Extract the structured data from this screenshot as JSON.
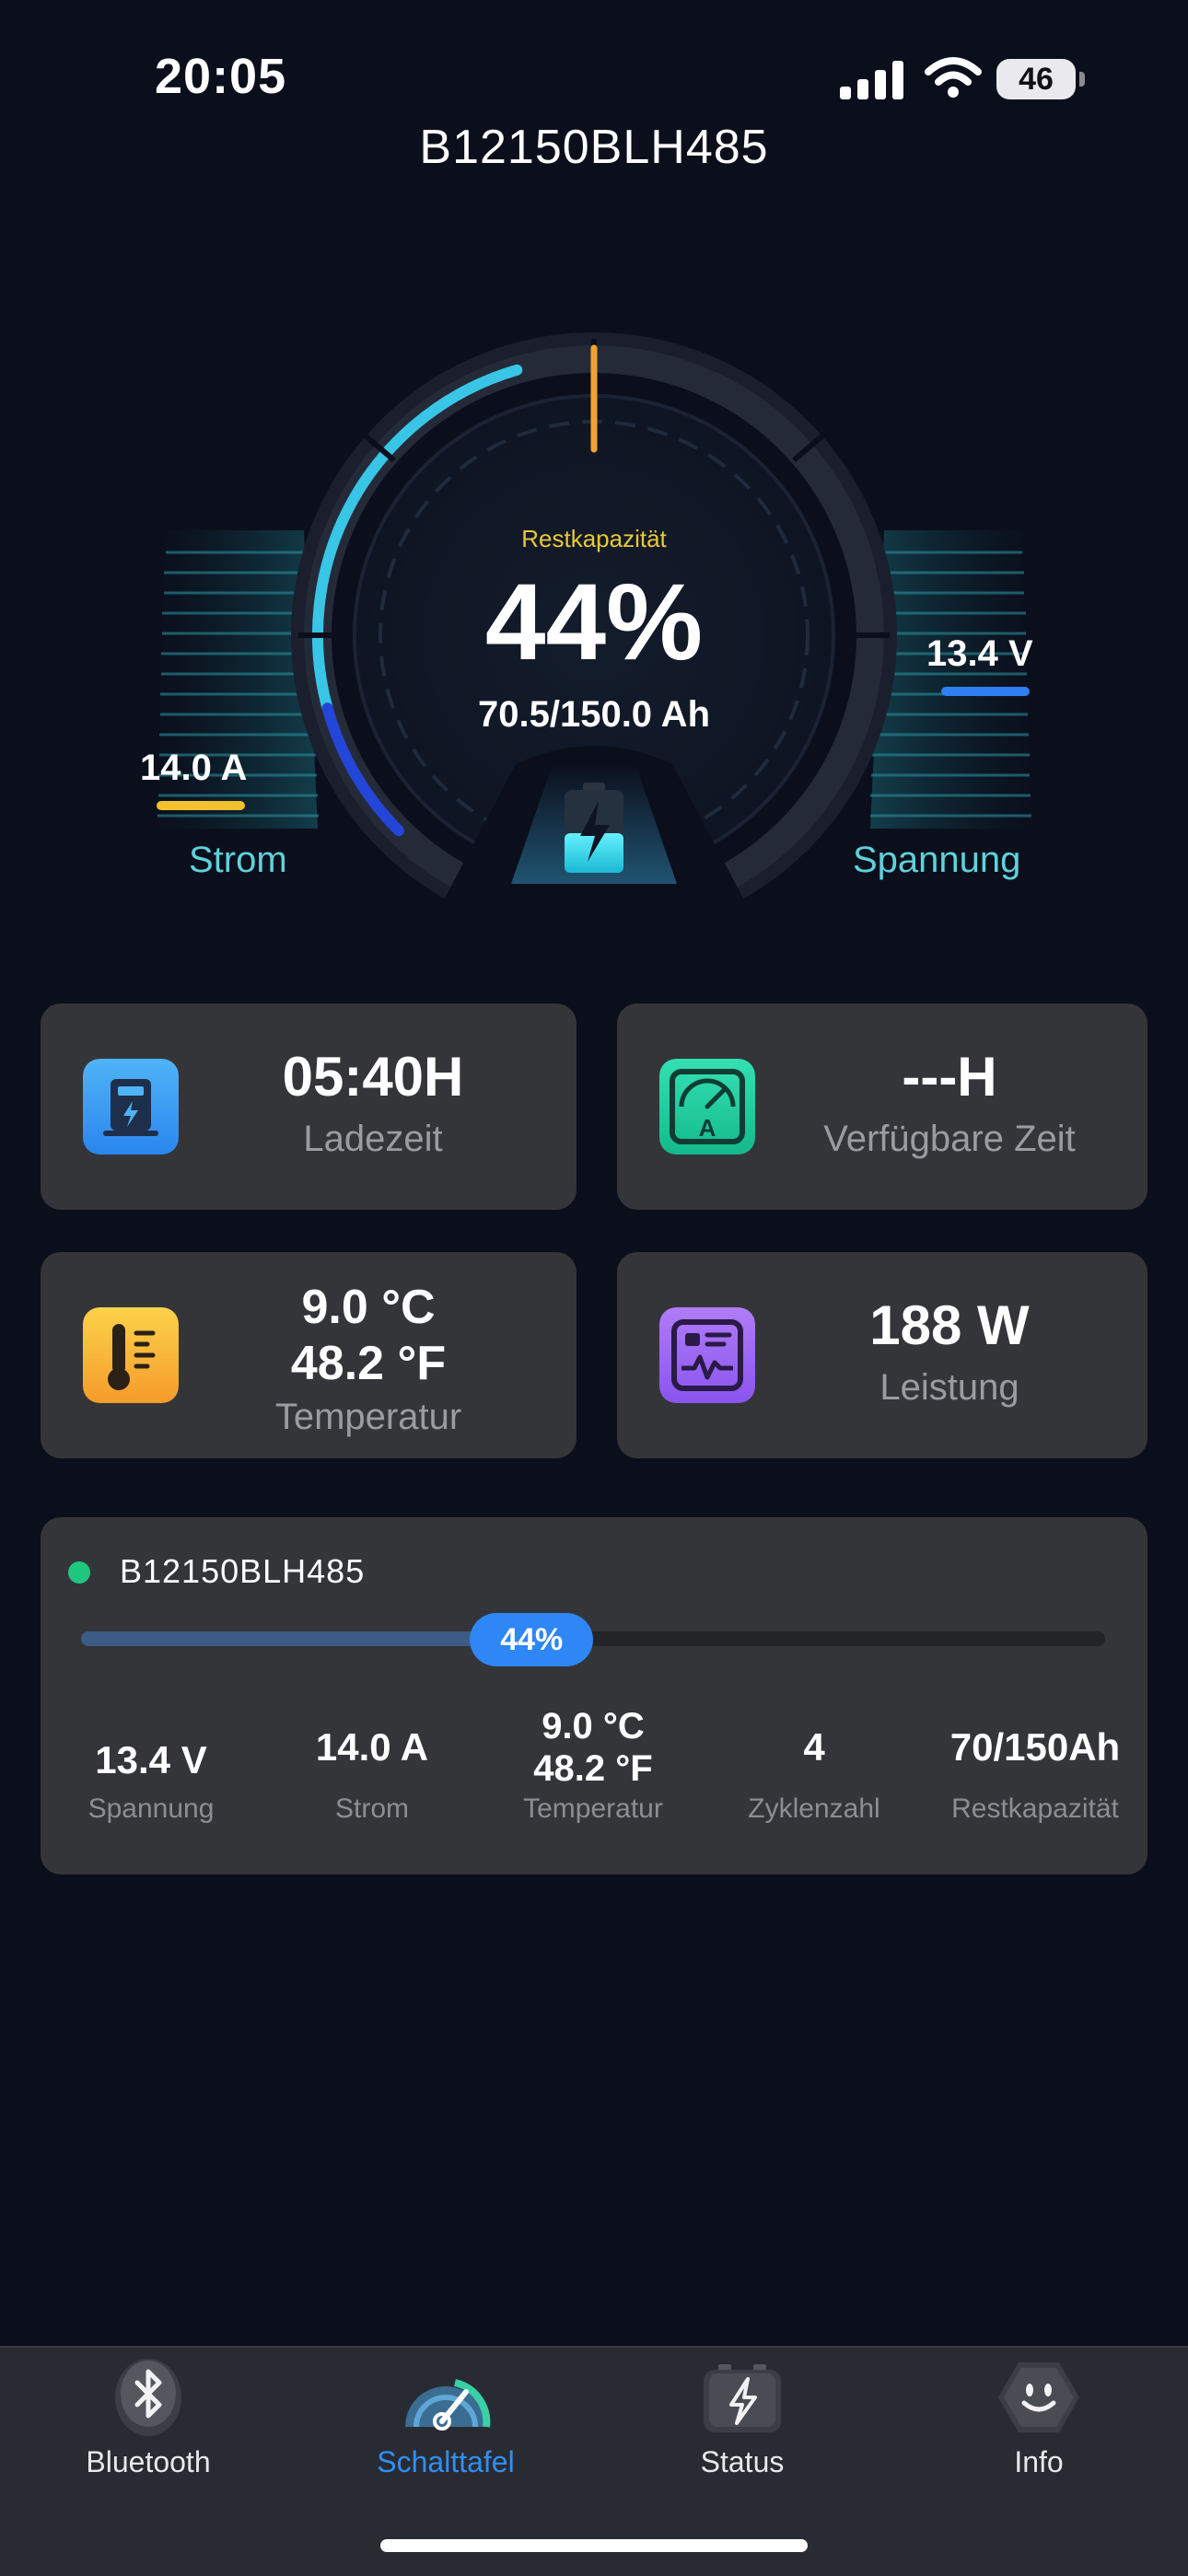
{
  "status_bar": {
    "time": "20:05",
    "battery": "46"
  },
  "header": {
    "title": "B12150BLH485"
  },
  "gauge": {
    "caption": "Restkapazität",
    "percent": "44%",
    "capacity": "70.5/150.0 Ah",
    "level": 0.44,
    "current_value": "14.0 A",
    "current_label": "Strom",
    "voltage_value": "13.4 V",
    "voltage_label": "Spannung"
  },
  "cards": {
    "charge": {
      "value": "05:40H",
      "label": "Ladezeit"
    },
    "available": {
      "value": "---H",
      "label": "Verfügbare Zeit"
    },
    "temperature": {
      "value_c": "9.0 °C",
      "value_f": "48.2 °F",
      "label": "Temperatur"
    },
    "power": {
      "value": "188 W",
      "label": "Leistung"
    }
  },
  "panel": {
    "name": "B12150BLH485",
    "progress_label": "44%",
    "progress": 0.44,
    "stats": [
      {
        "value": "13.4 V",
        "label": "Spannung"
      },
      {
        "value": "14.0 A",
        "label": "Strom"
      },
      {
        "value": "9.0 °C",
        "value2": "48.2 °F",
        "label": "Temperatur"
      },
      {
        "value": "4",
        "label": "Zyklenzahl"
      },
      {
        "value": "70/150Ah",
        "label": "Restkapazität"
      }
    ]
  },
  "tabs": [
    {
      "label": "Bluetooth",
      "icon": "bluetooth-icon"
    },
    {
      "label": "Schalttafel",
      "icon": "dashboard-gauge-icon",
      "active": true
    },
    {
      "label": "Status",
      "icon": "battery-status-icon"
    },
    {
      "label": "Info",
      "icon": "smiley-icon"
    }
  ],
  "colors": {
    "accent": "#2f8ff5",
    "current": "#f2c12e",
    "voltage": "#2f7ff0",
    "label_teal": "#5fd1da",
    "online": "#20c77f"
  }
}
